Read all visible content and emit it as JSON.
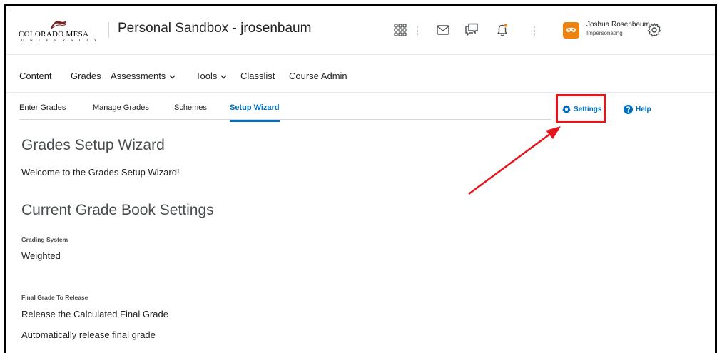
{
  "header": {
    "logo_name": "COLORADO MESA",
    "logo_sub": "U N I V E R S I T Y",
    "course_title": "Personal Sandbox - jrosenbaum",
    "user_name": "Joshua Rosenbaum",
    "user_role": "Impersonating",
    "icons": [
      "grid-icon",
      "mail-icon",
      "chat-icon",
      "bell-icon",
      "avatar-icon",
      "gear-icon"
    ],
    "notification_color": "#f0830f"
  },
  "nav": {
    "items": [
      {
        "label": "Content"
      },
      {
        "label": "Grades"
      },
      {
        "label": "Assessments"
      },
      {
        "label": "Tools"
      },
      {
        "label": "Classlist"
      },
      {
        "label": "Course Admin"
      }
    ]
  },
  "subtabs": {
    "items": [
      {
        "label": "Enter Grades"
      },
      {
        "label": "Manage Grades"
      },
      {
        "label": "Schemes"
      },
      {
        "label": "Setup Wizard",
        "active": true
      }
    ],
    "settings_label": "Settings",
    "help_label": "Help",
    "accent_color": "#006fbf",
    "highlight_color": "#e8141b"
  },
  "main": {
    "title": "Grades Setup Wizard",
    "welcome": "Welcome to the Grades Setup Wizard!",
    "section_title": "Current Grade Book Settings",
    "grading_system_label": "Grading System",
    "grading_system_value": "Weighted",
    "final_grade_label": "Final Grade To Release",
    "final_grade_value": "Release the Calculated Final Grade",
    "auto_release_value": "Automatically release final grade"
  }
}
